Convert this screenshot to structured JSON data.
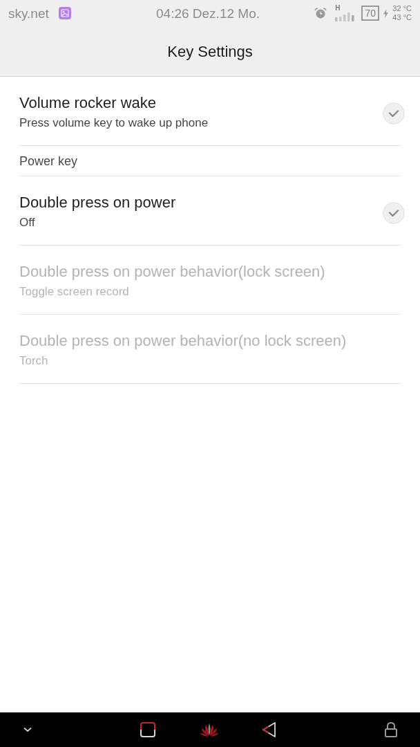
{
  "status_bar": {
    "carrier": "sky.net",
    "time": "04:26 Dez.12 Mo.",
    "network_type": "H",
    "battery": "70",
    "temperatures": [
      "32 °C",
      "43 °C"
    ]
  },
  "title_bar": {
    "title": "Key Settings"
  },
  "items": [
    {
      "kind": "check",
      "title": "Volume rocker wake",
      "summary": "Press volume key to wake up phone",
      "checked": true,
      "disabled": false
    },
    {
      "kind": "header",
      "title": "Power key"
    },
    {
      "kind": "check",
      "title": "Double press on power",
      "summary": "Off",
      "checked": true,
      "disabled": false
    },
    {
      "kind": "value",
      "title": "Double press on power behavior(lock screen)",
      "summary": "Toggle screen record",
      "disabled": true
    },
    {
      "kind": "value",
      "title": "Double press on power behavior(no lock screen)",
      "summary": "Torch",
      "disabled": true
    }
  ]
}
